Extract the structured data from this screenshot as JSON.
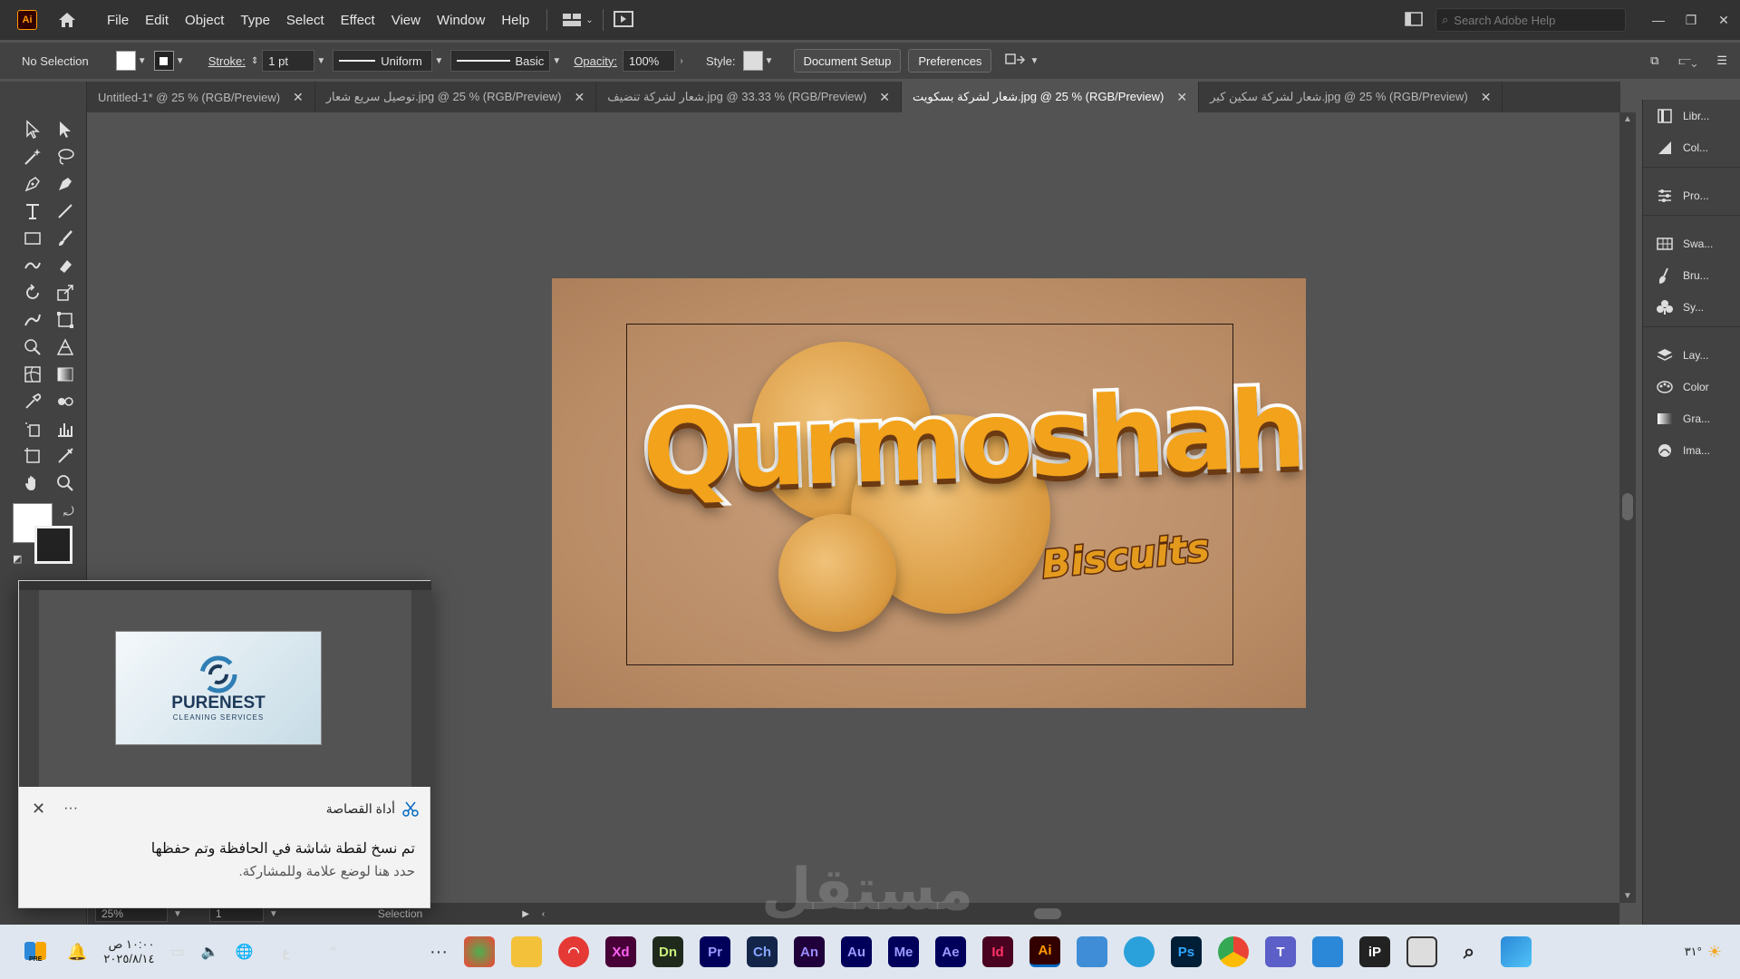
{
  "menubar": {
    "app_icon": "Ai",
    "items": [
      "File",
      "Edit",
      "Object",
      "Type",
      "Select",
      "Effect",
      "View",
      "Window",
      "Help"
    ],
    "search_placeholder": "Search Adobe Help"
  },
  "controlbar": {
    "selection": "No Selection",
    "stroke_label": "Stroke:",
    "stroke_value": "1 pt",
    "profile": "Uniform",
    "brush": "Basic",
    "opacity_label": "Opacity:",
    "opacity_value": "100%",
    "style_label": "Style:",
    "doc_setup": "Document Setup",
    "preferences": "Preferences"
  },
  "tabs": [
    {
      "label": "Untitled-1* @ 25 % (RGB/Preview)",
      "active": false
    },
    {
      "label": "توصيل سريع  شعار.jpg @ 25 % (RGB/Preview)",
      "active": false
    },
    {
      "label": "شعار لشركة تنضيف.jpg @ 33.33 % (RGB/Preview)",
      "active": false
    },
    {
      "label": "شعار لشركة بسكويت.jpg @ 25 % (RGB/Preview)",
      "active": true
    },
    {
      "label": "شعار لشركة سكين كير.jpg @ 25 % (RGB/Preview)",
      "active": false
    }
  ],
  "artboard": {
    "title": "Qurmoshah",
    "subtitle": "Biscuits"
  },
  "statusbar": {
    "zoom": "25%",
    "page": "1",
    "tool": "Selection"
  },
  "panels": [
    {
      "label": "Libr...",
      "icon": "libraries-icon"
    },
    {
      "label": "Col...",
      "icon": "color-guide-icon"
    },
    {
      "label": "Pro...",
      "icon": "properties-icon"
    },
    {
      "label": "Swa...",
      "icon": "swatches-icon"
    },
    {
      "label": "Bru...",
      "icon": "brushes-icon"
    },
    {
      "label": "Sy...",
      "icon": "symbols-icon"
    },
    {
      "label": "Lay...",
      "icon": "layers-icon"
    },
    {
      "label": "Color",
      "icon": "color-icon"
    },
    {
      "label": "Gra...",
      "icon": "gradient-icon"
    },
    {
      "label": "Ima...",
      "icon": "image-trace-icon"
    }
  ],
  "snip": {
    "title": "أداة القصاصة",
    "line1": "تم نسخ لقطة شاشة في الحافظة وتم حفظها",
    "line2": "حدد هنا لوضع علامة وللمشاركة.",
    "preview_brand": "PURENEST",
    "preview_sub": "CLEANING SERVICES"
  },
  "taskbar": {
    "time": "١٠:٠٠ ص",
    "date": "٢٠٢٥/٨/١٤",
    "lang": "ع",
    "temp": "٣١°",
    "apps": [
      {
        "label": "Xd",
        "bg": "#470137",
        "fg": "#ff61f6"
      },
      {
        "label": "Dn",
        "bg": "#1f2a1c",
        "fg": "#c8f07c"
      },
      {
        "label": "Pr",
        "bg": "#00005b",
        "fg": "#9999ff"
      },
      {
        "label": "Ch",
        "bg": "#14254a",
        "fg": "#87a6ff"
      },
      {
        "label": "An",
        "bg": "#1f003a",
        "fg": "#9a8cff"
      },
      {
        "label": "Au",
        "bg": "#00005b",
        "fg": "#9999ff"
      },
      {
        "label": "Me",
        "bg": "#00005b",
        "fg": "#9999ff"
      },
      {
        "label": "Ae",
        "bg": "#00005b",
        "fg": "#9999ff"
      },
      {
        "label": "Id",
        "bg": "#49021f",
        "fg": "#ff3366"
      },
      {
        "label": "Ai",
        "bg": "#330000",
        "fg": "#ff9a00"
      },
      {
        "label": "Ps",
        "bg": "#001e36",
        "fg": "#31a8ff"
      }
    ]
  },
  "colors": {
    "accent_ai": "#ff9a00",
    "workspace": "#535353"
  }
}
